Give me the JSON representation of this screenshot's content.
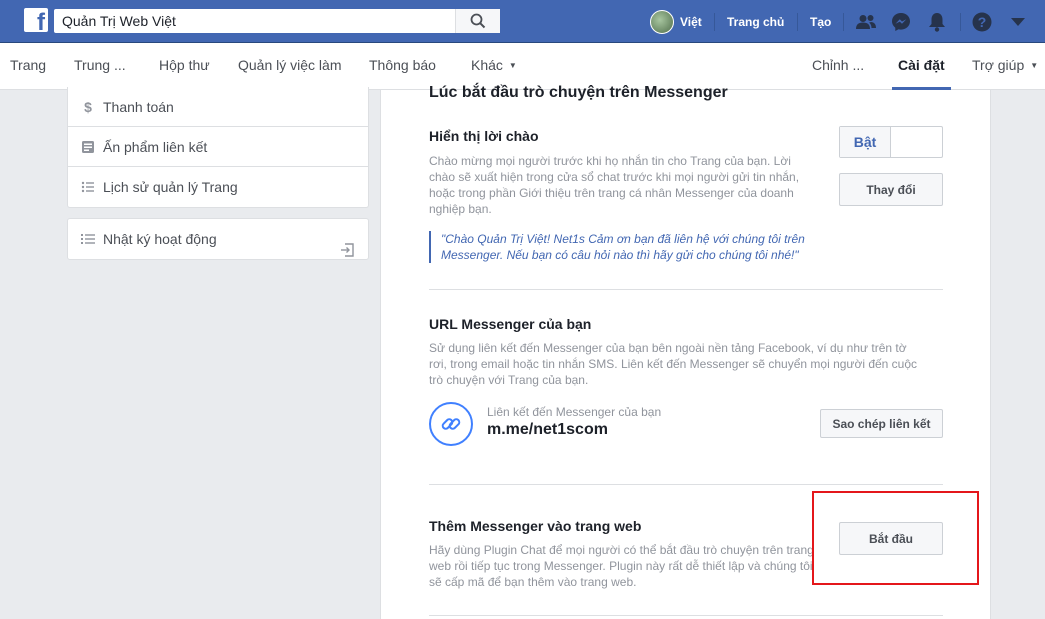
{
  "topbar": {
    "search_value": "Quản Trị Web Việt",
    "user_name": "Việt",
    "home_label": "Trang chủ",
    "create_label": "Tạo"
  },
  "subnav": {
    "items": [
      "Trang",
      "Trung ...",
      "Hộp thư",
      "Quản lý việc làm",
      "Thông báo",
      "Khác"
    ],
    "right_items": [
      "Chỉnh ...",
      "Cài đặt",
      "Trợ giúp"
    ]
  },
  "left_menu": {
    "items": [
      {
        "label": "Thanh toán",
        "icon": "dollar-icon"
      },
      {
        "label": "Ấn phẩm liên kết",
        "icon": "publication-icon"
      },
      {
        "label": "Lịch sử quản lý Trang",
        "icon": "history-icon"
      }
    ],
    "activity_log": "Nhật ký hoạt động"
  },
  "main": {
    "section_heading": "Lúc bắt đầu trò chuyện trên Messenger",
    "greeting": {
      "title": "Hiển thị lời chào",
      "desc_lines": [
        "Chào mừng mọi người trước khi họ nhắn tin cho Trang của bạn. Lời",
        "chào sẽ xuất hiện trong cửa sổ chat trước khi mọi người gửi tin nhắn,",
        "hoặc trong phần Giới thiệu trên trang cá nhân Messenger của doanh",
        "nghiệp bạn."
      ],
      "quote_lines": [
        "\"Chào Quản Trị Việt! Net1s Cảm ơn bạn đã liên hệ với chúng tôi trên",
        "Messenger. Nếu bạn có câu hỏi nào thì hãy gửi cho chúng tôi nhé!\""
      ],
      "toggle_label": "Bật",
      "change_button": "Thay đổi"
    },
    "url": {
      "title": "URL Messenger của bạn",
      "desc_lines": [
        "Sử dụng liên kết đến Messenger của bạn bên ngoài nền tảng Facebook, ví dụ như trên tờ",
        "rơi, trong email hoặc tin nhắn SMS. Liên kết đến Messenger sẽ chuyển mọi người đến cuộc",
        "trò chuyện với Trang của bạn."
      ],
      "link_label": "Liên kết đến Messenger của bạn",
      "link_value": "m.me/net1scom",
      "copy_button": "Sao chép liên kết"
    },
    "plugin": {
      "title": "Thêm Messenger vào trang web",
      "desc_lines": [
        "Hãy dùng Plugin Chat để mọi người có thể bắt đầu trò chuyện trên trang",
        "web rồi tiếp tục trong Messenger. Plugin này rất dễ thiết lập và chúng tôi",
        "sẽ cấp mã để bạn thêm vào trang web."
      ],
      "start_button": "Bắt đầu"
    }
  },
  "colors": {
    "brand": "#4267b2",
    "highlight": "#e4171b"
  }
}
